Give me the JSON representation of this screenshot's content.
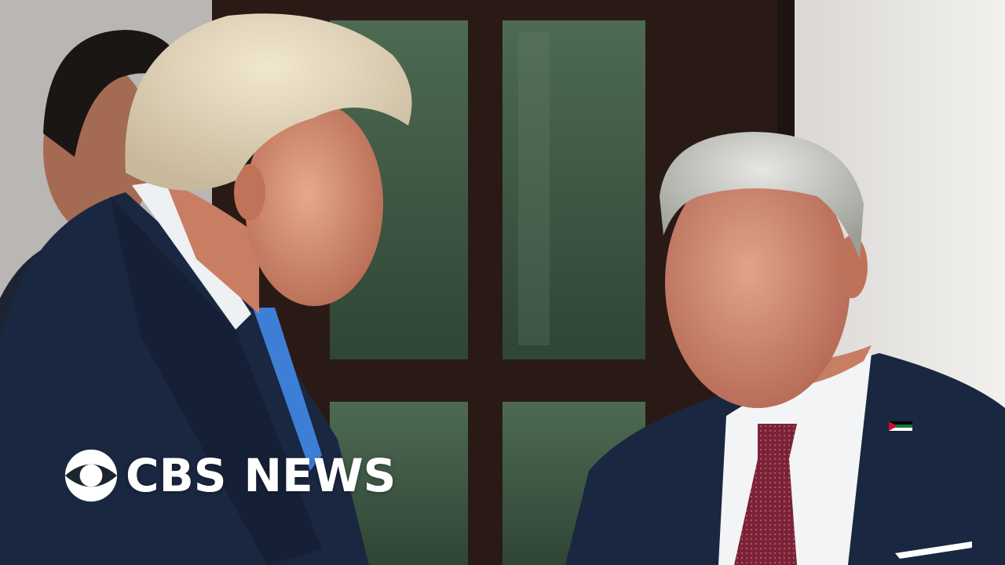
{
  "brand": {
    "network": "CBS",
    "division": "NEWS",
    "logo_icon": "cbs-eye-icon",
    "text_color": "#ffffff"
  },
  "scene": {
    "door_glass_color": "#3f5a44",
    "door_frame_color": "#2a1a16",
    "wall_color": "#eceae8",
    "suit_color": "#1a2740",
    "tie_left_color": "#3d7fd6",
    "tie_right_color": "#7a2236",
    "pin_icon": "flag-pin-icon"
  }
}
